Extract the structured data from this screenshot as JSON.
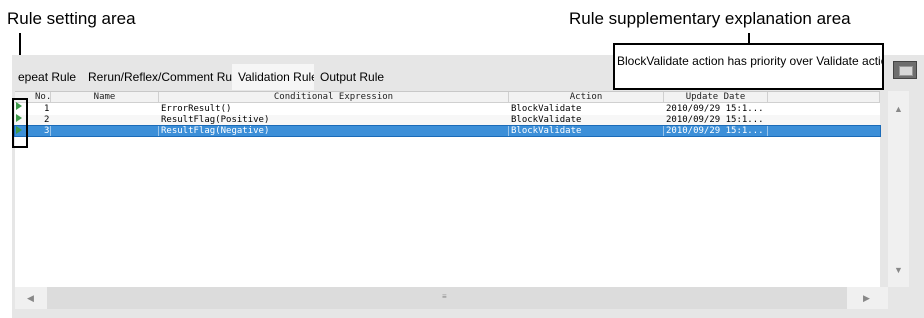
{
  "callouts": {
    "left": "Rule setting area",
    "right": "Rule supplementary explanation area"
  },
  "tabs": [
    {
      "label": "epeat Rule",
      "active": false
    },
    {
      "label": "Rerun/Reflex/Comment Rule",
      "active": false
    },
    {
      "label": "Validation Rule",
      "active": true
    },
    {
      "label": "Output Rule",
      "active": false
    }
  ],
  "explanation": "BlockValidate action has priority over Validate action.",
  "columns": {
    "no": "No.",
    "name": "Name",
    "expr": "Conditional Expression",
    "action": "Action",
    "date": "Update Date"
  },
  "rows": [
    {
      "no": "1",
      "name": "",
      "expr": "ErrorResult()",
      "action": "BlockValidate",
      "date": "2010/09/29 15:1...",
      "selected": false
    },
    {
      "no": "2",
      "name": "",
      "expr": "ResultFlag(Positive)",
      "action": "BlockValidate",
      "date": "2010/09/29 15:1...",
      "selected": false
    },
    {
      "no": "3",
      "name": "",
      "expr": "ResultFlag(Negative)",
      "action": "BlockValidate",
      "date": "2010/09/29 15:1...",
      "selected": true
    }
  ],
  "colors": {
    "selection": "#3c8fd8",
    "run_icon": "#3e9a4a"
  }
}
